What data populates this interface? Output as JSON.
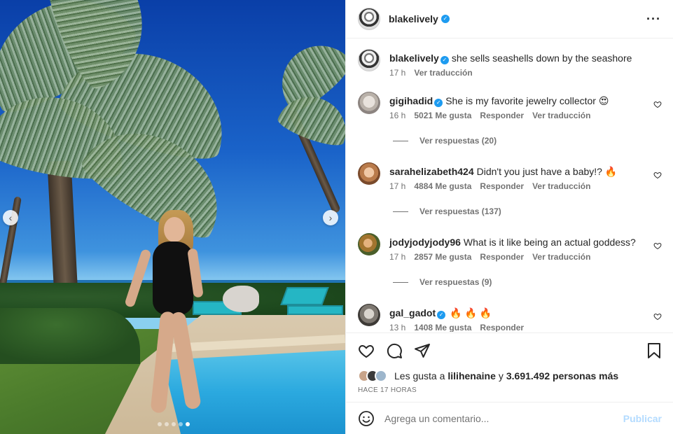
{
  "post": {
    "author": "blakelively",
    "caption": "she sells seashells down by the seashore",
    "caption_time": "17 h",
    "caption_translate": "Ver traducción"
  },
  "comments": [
    {
      "user": "gigihadid",
      "verified": true,
      "text": "She is my favorite jewelry collector 😍",
      "time": "16 h",
      "likes": "5021 Me gusta",
      "reply": "Responder",
      "translate": "Ver traducción",
      "replies": "Ver respuestas (20)"
    },
    {
      "user": "sarahelizabeth424",
      "verified": false,
      "text": "Didn't you just have a baby!? 🔥",
      "time": "17 h",
      "likes": "4884 Me gusta",
      "reply": "Responder",
      "translate": "Ver traducción",
      "replies": "Ver respuestas (137)"
    },
    {
      "user": "jodyjodyjody96",
      "verified": false,
      "text": "What is it like being an actual goddess?",
      "time": "17 h",
      "likes": "2857 Me gusta",
      "reply": "Responder",
      "translate": "Ver traducción",
      "replies": "Ver respuestas (9)"
    },
    {
      "user": "gal_gadot",
      "verified": true,
      "text": "🔥 🔥 🔥",
      "time": "13 h",
      "likes": "1408 Me gusta",
      "reply": "Responder"
    }
  ],
  "likes_line": {
    "prefix": "Les gusta a",
    "user": "lilihenaine",
    "connector": "y",
    "others": "3.691.492 personas más"
  },
  "timestamp": "HACE 17 HORAS",
  "add_comment": {
    "placeholder": "Agrega un comentario...",
    "publish": "Publicar"
  },
  "colors": {
    "verified": "#1d9bf0",
    "muted": "#737373",
    "publish_disabled": "#b3dbff"
  },
  "icons": [
    "more-icon",
    "heart-icon",
    "comment-icon",
    "share-icon",
    "bookmark-icon",
    "emoji-icon",
    "chevron-left-icon",
    "chevron-right-icon"
  ]
}
